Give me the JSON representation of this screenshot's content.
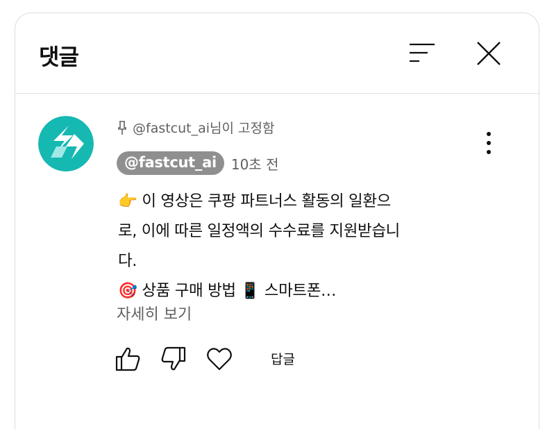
{
  "header": {
    "title": "댓글",
    "sort_icon": "sort-icon",
    "close_icon": "close-icon"
  },
  "comment": {
    "pinned_text": "@fastcut_ai님이 고정함",
    "author": "@fastcut_ai",
    "timestamp": "10초 전",
    "body_lines": [
      "👉 이 영상은 쿠팡 파트너스 활동의 일환으",
      "로, 이에 따른 일정액의 수수료를 지원받습니",
      "다.",
      "🎯 상품 구매 방법 📱 스마트폰…"
    ],
    "read_more": "자세히 보기",
    "reply_label": "답글",
    "avatar_colors": {
      "bg": "#16b8b2",
      "mark": "#ffffff",
      "mark_light": "#9fe9e6"
    }
  },
  "colors": {
    "chip_bg": "#8f8f8f",
    "secondary_text": "#606060",
    "divider": "#e2e2e2"
  }
}
